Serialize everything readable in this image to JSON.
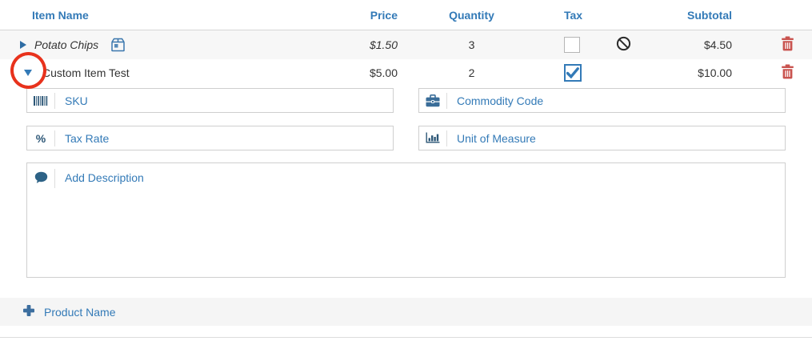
{
  "header": {
    "item_name": "Item Name",
    "price": "Price",
    "quantity": "Quantity",
    "tax": "Tax",
    "subtotal": "Subtotal"
  },
  "rows": [
    {
      "name": "Potato Chips",
      "price": "$1.50",
      "quantity": "3",
      "tax_checked": false,
      "tax_exempt_marker": "no-symbol",
      "subtotal": "$4.50"
    },
    {
      "name": "Custom Item Test",
      "price": "$5.00",
      "quantity": "2",
      "tax_checked": true,
      "subtotal": "$10.00"
    }
  ],
  "expanded_fields": {
    "sku_placeholder": "SKU",
    "commodity_code_placeholder": "Commodity Code",
    "tax_rate_placeholder": "Tax Rate",
    "tax_rate_icon": "%",
    "unit_of_measure_placeholder": "Unit of Measure",
    "description_placeholder": "Add Description"
  },
  "add_row": {
    "label": "Product Name"
  },
  "colors": {
    "accent_blue": "#337ab7",
    "icon_navy": "#2d5777",
    "danger_red": "#c9534f",
    "annotation_red": "#e8321c",
    "row_stripe": "#f7f7f7",
    "add_row_bg": "#f5f5f5"
  }
}
